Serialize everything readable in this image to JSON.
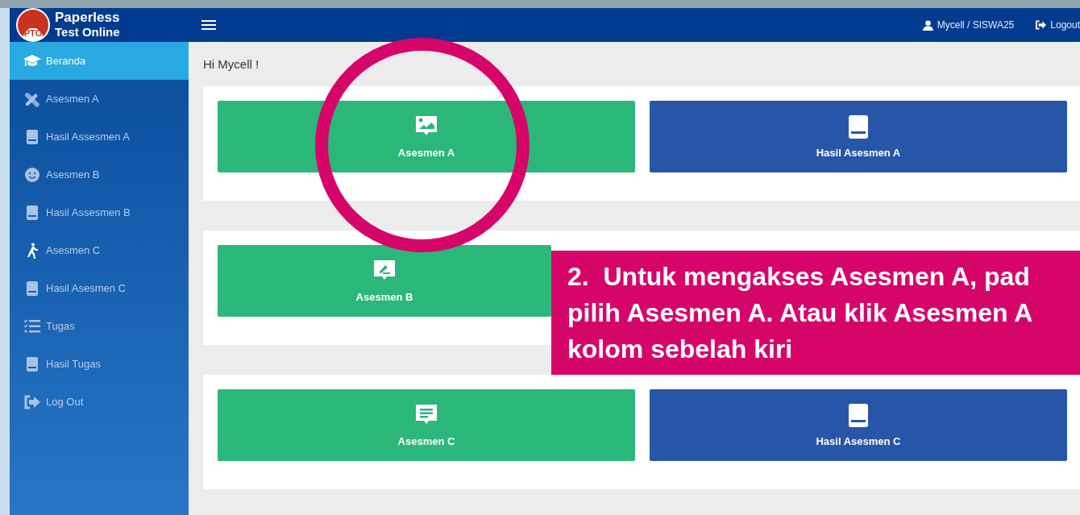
{
  "header": {
    "logo_badge": "PTO",
    "brand_line_1": "Paperless",
    "brand_line_2": "Test Online",
    "user": "Mycell / SISWA25",
    "logout": "Logout"
  },
  "sidebar": {
    "items": [
      {
        "label": "Beranda",
        "kind": "graduation",
        "selected": true
      },
      {
        "label": "Asesmen A",
        "kind": "tools",
        "selected": false
      },
      {
        "label": "Hasil Assesmen A",
        "kind": "book",
        "selected": false
      },
      {
        "label": "Asesmen B",
        "kind": "smile",
        "selected": false
      },
      {
        "label": "Hasil Assesmen B",
        "kind": "book",
        "selected": false
      },
      {
        "label": "Asesmen C",
        "kind": "walk",
        "selected": false
      },
      {
        "label": "Hasil Asesmen C",
        "kind": "book",
        "selected": false
      },
      {
        "label": "Tugas",
        "kind": "tasks",
        "selected": false
      },
      {
        "label": "Hasil Tugas",
        "kind": "book",
        "selected": false
      },
      {
        "label": "Log Out",
        "kind": "logout",
        "selected": false
      }
    ]
  },
  "greeting": "Hi Mycell !",
  "panels": [
    {
      "tiles": [
        {
          "label": "Asesmen A",
          "kind": "picture"
        },
        {
          "label": "Hasil Asesmen A",
          "kind": "book"
        }
      ]
    },
    {
      "tiles": [
        {
          "label": "Asesmen B",
          "kind": "edit"
        }
      ]
    },
    {
      "tiles": [
        {
          "label": "Asesmen C",
          "kind": "comment"
        },
        {
          "label": "Hasil Asesmen C",
          "kind": "book"
        }
      ]
    }
  ],
  "callout": {
    "lines": [
      "2.  Untuk mengakses Asesmen A, pad",
      "pilih Asesmen A. Atau klik Asesmen A",
      "kolom sebelah kiri"
    ]
  }
}
